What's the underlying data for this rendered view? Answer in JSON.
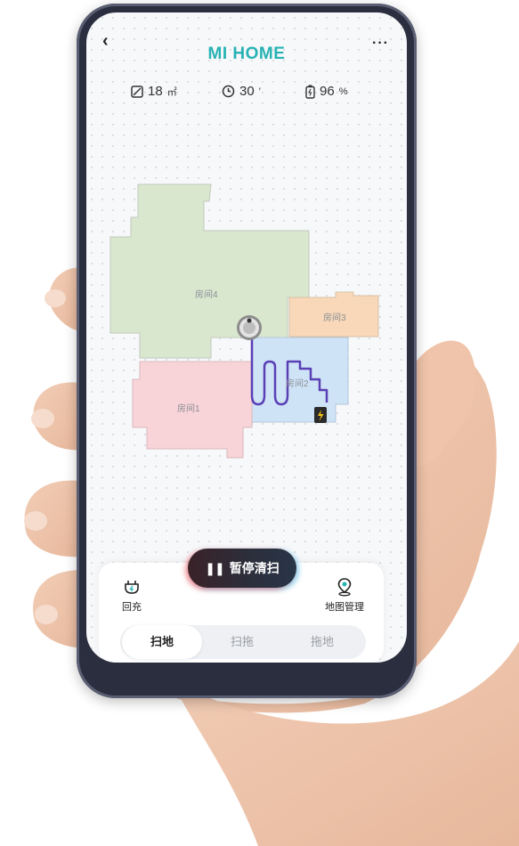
{
  "app": {
    "title": "MI HOME"
  },
  "header": {
    "back_icon": "chevron-left-icon",
    "more_label": "···"
  },
  "stats": [
    {
      "icon": "area-icon",
      "value": "18",
      "unit": "㎡"
    },
    {
      "icon": "clock-icon",
      "value": "30",
      "unit": "′"
    },
    {
      "icon": "battery-icon",
      "value": "96",
      "unit": "%"
    }
  ],
  "map": {
    "rooms": [
      {
        "label": "房间4",
        "color": "#d9e7cf"
      },
      {
        "label": "房间3",
        "color": "#f8d8b8"
      },
      {
        "label": "房间2",
        "color": "#cfe3f7"
      },
      {
        "label": "房间1",
        "color": "#f8d3d8"
      }
    ],
    "path_color": "#5a3fb5",
    "dock_icon": "charging-dock-icon",
    "robot_icon": "robot-vacuum-icon"
  },
  "controls": {
    "pause_label": "暂停清扫",
    "recharge_label": "回充",
    "map_manage_label": "地图管理"
  },
  "modes": [
    {
      "label": "扫地",
      "active": true
    },
    {
      "label": "扫拖",
      "active": false
    },
    {
      "label": "拖地",
      "active": false
    }
  ],
  "colors": {
    "accent": "#27b2b4",
    "background": "#f7f8fa"
  }
}
